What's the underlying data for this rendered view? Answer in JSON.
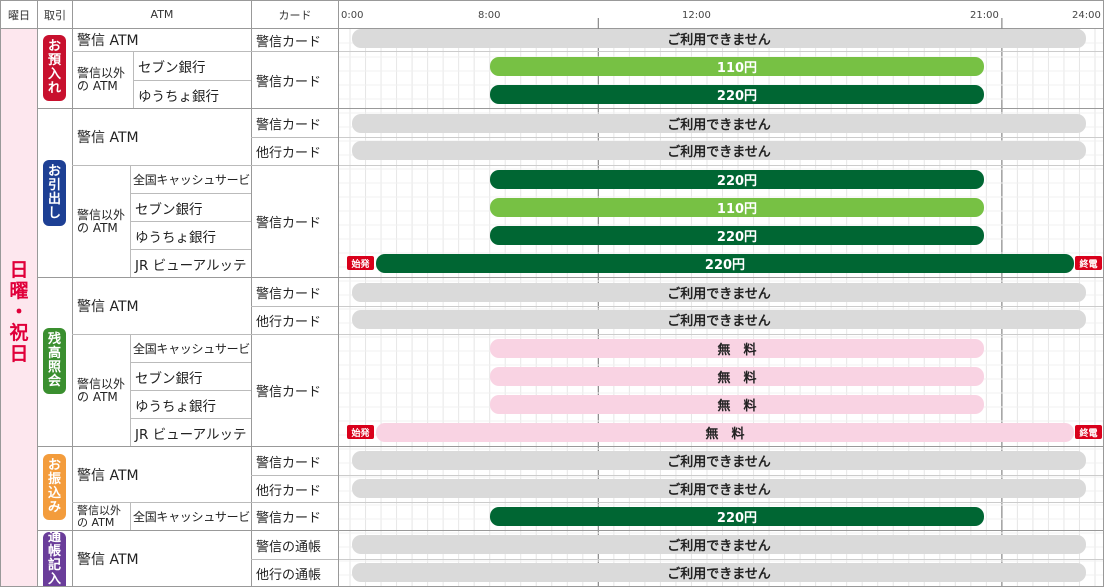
{
  "header": {
    "day": "曜日",
    "trans": "取引",
    "atm": "ATM",
    "card": "カード",
    "times": [
      "0:00",
      "8:00",
      "12:00",
      "21:00",
      "24:00"
    ]
  },
  "day_label": [
    "日",
    "曜",
    "・",
    "祝",
    "日"
  ],
  "categories": [
    {
      "label": [
        "お",
        "預",
        "入",
        "れ"
      ],
      "color": "#c8102e"
    },
    {
      "label": [
        "お",
        "引",
        "出",
        "し"
      ],
      "color": "#1d3f94"
    },
    {
      "label": [
        "残",
        "高",
        "照",
        "会"
      ],
      "color": "#3a8f2f"
    },
    {
      "label": [
        "お",
        "振",
        "込",
        "み"
      ],
      "color": "#f39c3c"
    },
    {
      "label": [
        "通",
        "帳",
        "記",
        "入"
      ],
      "color": "#6a3d9a"
    }
  ],
  "atm": {
    "keishin": "警信 ATM",
    "other_line1": "警信以外",
    "other_line2": "の ATM"
  },
  "banks": {
    "zenkoku": "全国キャッシュサービス",
    "seven": "セブン銀行",
    "yucho": "ゆうちょ銀行",
    "jr": "JR ビューアルッテ"
  },
  "cards": {
    "keishin": "警信カード",
    "other": "他行カード",
    "passbook": "警信の通帳",
    "other_passbook": "他行の通帳"
  },
  "bar_labels": {
    "unavailable": "ご利用できません",
    "yen110": "110円",
    "yen220": "220円",
    "free": "無　料"
  },
  "tags": {
    "start": "始発",
    "end": "終電"
  },
  "colors": {
    "gray": "#dadada",
    "light_green": "#77c144",
    "dark_green": "#006633",
    "pink": "#f9d3e3",
    "accent": "#e0003a"
  }
}
